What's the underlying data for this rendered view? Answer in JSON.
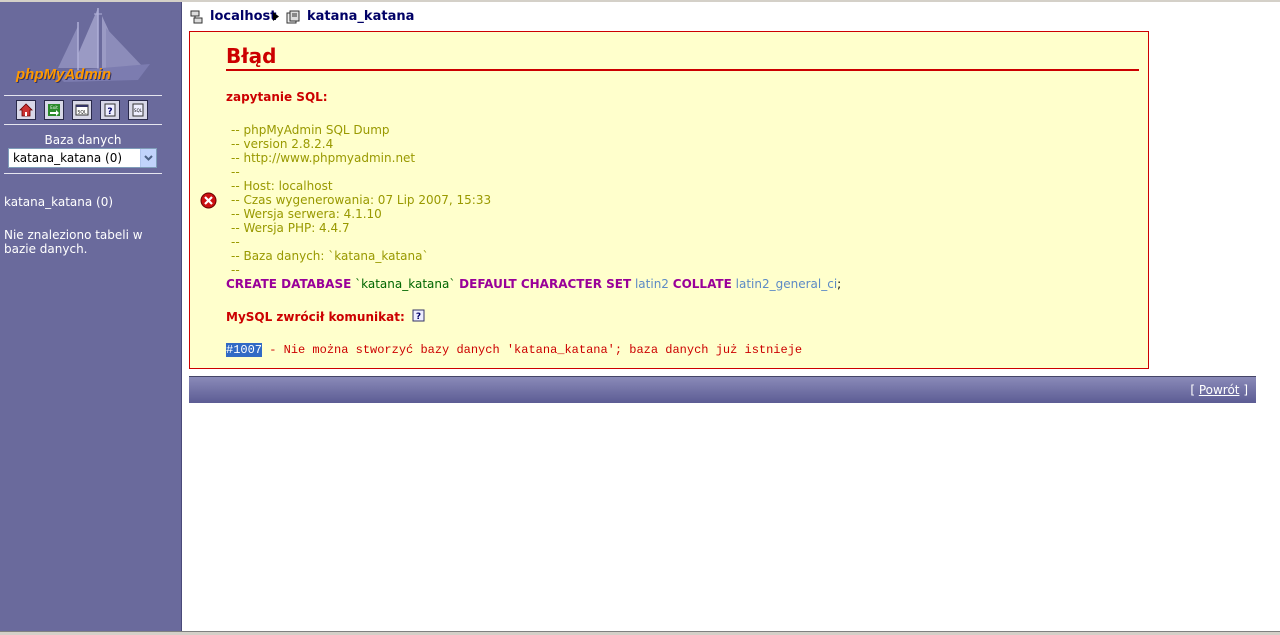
{
  "sidebar": {
    "logo_text": "phpMyAdmin",
    "icons": [
      "home-icon",
      "exit-icon",
      "sql-query-icon",
      "help-icon",
      "sql-docs-icon"
    ],
    "db_label": "Baza danych",
    "db_selected": "katana_katana (0)",
    "db_name": "katana_katana (0)",
    "no_tables": "Nie znaleziono tabeli w bazie danych."
  },
  "breadcrumb": {
    "server": "localhost",
    "database": "katana_katana"
  },
  "error": {
    "title": "Błąd",
    "sql_label": "zapytanie SQL:",
    "sql_comments": "-- phpMyAdmin SQL Dump\n-- version 2.8.2.4\n-- http://www.phpmyadmin.net\n--\n-- Host: localhost\n-- Czas wygenerowania: 07 Lip 2007, 15:33\n-- Wersja serwera: 4.1.10\n-- Wersja PHP: 4.4.7\n--\n-- Baza danych: `katana_katana`\n--",
    "stmt": {
      "kw_create": "CREATE DATABASE",
      "ident": "`katana_katana`",
      "kw_charset": "DEFAULT CHARACTER SET",
      "charset": "latin2",
      "kw_collate": "COLLATE",
      "collate": "latin2_general_ci",
      "end": ";"
    },
    "mysql_label": "MySQL zwrócił komunikat:",
    "code": "#1007",
    "message": " - Nie można stworzyć bazy danych 'katana_katana'; baza danych już istnieje"
  },
  "footer": {
    "back_open": "[ ",
    "back_label": "Powrót",
    "back_close": " ]"
  },
  "colors": {
    "sidebar_bg": "#6a6a9c",
    "error_bg": "#ffffcc",
    "error_red": "#cc0000",
    "keyword": "#990099"
  }
}
